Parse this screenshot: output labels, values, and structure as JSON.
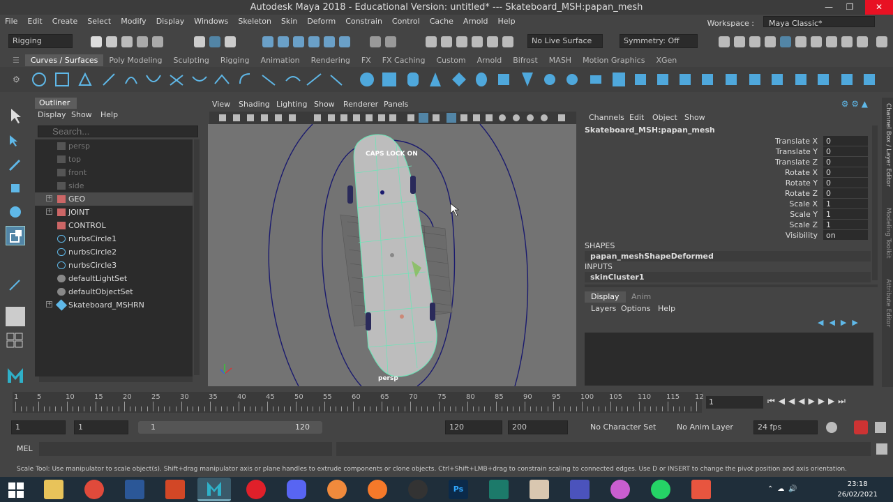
{
  "title": "Autodesk Maya 2018 - Educational Version: untitled*   ---   Skateboard_MSH:papan_mesh",
  "menu": [
    "File",
    "Edit",
    "Create",
    "Select",
    "Modify",
    "Display",
    "Windows",
    "Skeleton",
    "Skin",
    "Deform",
    "Constrain",
    "Control",
    "Cache",
    "Arnold",
    "Help"
  ],
  "workspace": {
    "label": "Workspace :",
    "value": "Maya Classic*"
  },
  "status": {
    "mode": "Rigging",
    "live_surface": "No Live Surface",
    "symmetry": "Symmetry: Off"
  },
  "shelf_tabs": [
    "Curves / Surfaces",
    "Poly Modeling",
    "Sculpting",
    "Rigging",
    "Animation",
    "Rendering",
    "FX",
    "FX Caching",
    "Custom",
    "Arnold",
    "Bifrost",
    "MASH",
    "Motion Graphics",
    "XGen"
  ],
  "outliner": {
    "title": "Outliner",
    "menu": [
      "Display",
      "Show",
      "Help"
    ],
    "search_placeholder": "Search...",
    "items": [
      "persp",
      "top",
      "front",
      "side",
      "GEO",
      "JOINT",
      "CONTROL",
      "nurbsCircle1",
      "nurbsCircle2",
      "nurbsCircle3",
      "defaultLightSet",
      "defaultObjectSet",
      "Skateboard_MSHRN"
    ]
  },
  "viewport": {
    "menu": [
      "View",
      "Shading",
      "Lighting",
      "Show",
      "Renderer",
      "Panels"
    ],
    "caps_lock": "CAPS LOCK ON",
    "camera": "persp"
  },
  "channel_box": {
    "menu": [
      "Channels",
      "Edit",
      "Object",
      "Show"
    ],
    "object": "Skateboard_MSH:papan_mesh",
    "attrs": [
      {
        "name": "Translate X",
        "value": "0"
      },
      {
        "name": "Translate Y",
        "value": "0"
      },
      {
        "name": "Translate Z",
        "value": "0"
      },
      {
        "name": "Rotate X",
        "value": "0"
      },
      {
        "name": "Rotate Y",
        "value": "0"
      },
      {
        "name": "Rotate Z",
        "value": "0"
      },
      {
        "name": "Scale X",
        "value": "1"
      },
      {
        "name": "Scale Y",
        "value": "1"
      },
      {
        "name": "Scale Z",
        "value": "1"
      },
      {
        "name": "Visibility",
        "value": "on"
      }
    ],
    "shapes_label": "SHAPES",
    "shape": "papan_meshShapeDeformed",
    "inputs_label": "INPUTS",
    "input": "skinCluster1",
    "layer_tabs": [
      "Display",
      "Anim"
    ],
    "layer_menu": [
      "Layers",
      "Options",
      "Help"
    ]
  },
  "side_tabs": [
    "Channel Box / Layer Editor",
    "Modeling Toolkit",
    "Attribute Editor"
  ],
  "timeline": {
    "ticks": [
      "1",
      "5",
      "10",
      "15",
      "20",
      "25",
      "30",
      "35",
      "40",
      "45",
      "50",
      "55",
      "60",
      "65",
      "70",
      "75",
      "80",
      "85",
      "90",
      "95",
      "100",
      "105",
      "110",
      "115",
      "12"
    ],
    "current": "1"
  },
  "range": {
    "start": "1",
    "start2": "1",
    "slider_start": "1",
    "slider_end": "120",
    "end": "120",
    "end2": "200",
    "character": "No Character Set",
    "anim_layer": "No Anim Layer",
    "fps": "24 fps"
  },
  "mel": "MEL",
  "help_line": "Scale Tool: Use manipulator to scale object(s). Shift+drag manipulator axis or plane handles to extrude components or clone objects. Ctrl+Shift+LMB+drag to constrain scaling to connected edges. Use D or INSERT to change the pivot position and axis orientation.",
  "clock": {
    "time": "23:18",
    "date": "26/02/2021"
  },
  "colors": {
    "accent": "#5285a6",
    "wire": "#6fe4b8",
    "curve": "#1a1a6e"
  }
}
